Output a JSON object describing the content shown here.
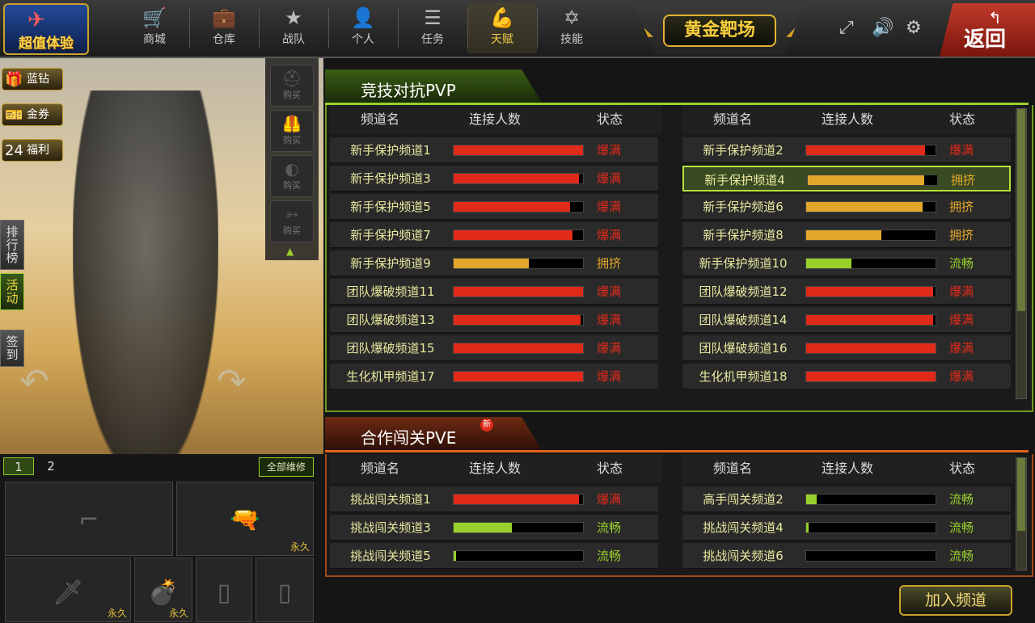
{
  "topbar": {
    "promo_label": "超值体验",
    "nav": [
      {
        "id": "shop",
        "label": "商城",
        "icon": "cart-icon",
        "glyph": "🛒"
      },
      {
        "id": "warehouse",
        "label": "仓库",
        "icon": "briefcase-icon",
        "glyph": "💼"
      },
      {
        "id": "team",
        "label": "战队",
        "icon": "badge-icon",
        "glyph": "★"
      },
      {
        "id": "profile",
        "label": "个人",
        "icon": "person-icon",
        "glyph": "👤"
      },
      {
        "id": "tasks",
        "label": "任务",
        "icon": "list-icon",
        "glyph": "☰"
      },
      {
        "id": "talent",
        "label": "天赋",
        "icon": "muscle-icon",
        "glyph": "💪"
      },
      {
        "id": "skills",
        "label": "技能",
        "icon": "star-of-david-icon",
        "glyph": "✡"
      }
    ],
    "active_nav": "talent",
    "mode_title": "黄金靶场",
    "back_label": "返回"
  },
  "left": {
    "side_buttons": [
      {
        "label": "蓝钻",
        "icon": "gift-icon",
        "glyph": "🎁"
      },
      {
        "label": "金券",
        "icon": "coupon-icon",
        "glyph": "🎫"
      },
      {
        "label": "福利",
        "icon": "calendar-icon",
        "glyph": "24"
      }
    ],
    "rank_tabs": [
      {
        "label": "排行榜",
        "active": false
      },
      {
        "label": "活动",
        "active": true
      },
      {
        "label": "签到",
        "active": false
      }
    ],
    "buy_label": "购买",
    "buy_items": [
      {
        "icon": "helmet-icon",
        "glyph": "⛑"
      },
      {
        "icon": "vest-icon",
        "glyph": "🦺"
      },
      {
        "icon": "shield-icon",
        "glyph": "◐"
      },
      {
        "icon": "gun-icon",
        "glyph": "➳"
      }
    ]
  },
  "loadout": {
    "tabs": [
      "1",
      "2"
    ],
    "repair_label": "全部维修",
    "permanent_label": "永久",
    "slots": [
      {
        "icon": "rifle-icon",
        "glyph": "⌐",
        "permanent": false
      },
      {
        "icon": "pistol-icon",
        "glyph": "🔫",
        "permanent": true
      },
      {
        "icon": "knife-icon",
        "glyph": "🗡",
        "permanent": true
      },
      {
        "icon": "grenade-icon",
        "glyph": "💣",
        "permanent": true
      },
      {
        "icon": "empty-slot-icon",
        "glyph": "▯",
        "permanent": false
      },
      {
        "icon": "empty-slot-icon",
        "glyph": "▯",
        "permanent": false
      }
    ]
  },
  "pvp": {
    "title": "竞技对抗PVP",
    "col_name": "频道名",
    "col_conn": "连接人数",
    "col_status": "状态",
    "channels": [
      {
        "name": "新手保护频道1",
        "fill": 1.0,
        "status": "爆满",
        "color": "#e02a1a"
      },
      {
        "name": "新手保护频道2",
        "fill": 0.92,
        "status": "爆满",
        "color": "#e02a1a"
      },
      {
        "name": "新手保护频道3",
        "fill": 0.97,
        "status": "爆满",
        "color": "#e02a1a"
      },
      {
        "name": "新手保护频道4",
        "fill": 0.9,
        "status": "拥挤",
        "color": "#e2a72a"
      },
      {
        "name": "新手保护频道5",
        "fill": 0.9,
        "status": "爆满",
        "color": "#e02a1a"
      },
      {
        "name": "新手保护频道6",
        "fill": 0.9,
        "status": "拥挤",
        "color": "#e2a72a"
      },
      {
        "name": "新手保护频道7",
        "fill": 0.92,
        "status": "爆满",
        "color": "#e02a1a"
      },
      {
        "name": "新手保护频道8",
        "fill": 0.58,
        "status": "拥挤",
        "color": "#e2a72a"
      },
      {
        "name": "新手保护频道9",
        "fill": 0.58,
        "status": "拥挤",
        "color": "#e2a72a"
      },
      {
        "name": "新手保护频道10",
        "fill": 0.35,
        "status": "流畅",
        "color": "#9ad02c"
      },
      {
        "name": "团队爆破频道11",
        "fill": 1.0,
        "status": "爆满",
        "color": "#e02a1a"
      },
      {
        "name": "团队爆破频道12",
        "fill": 0.98,
        "status": "爆满",
        "color": "#e02a1a"
      },
      {
        "name": "团队爆破频道13",
        "fill": 0.98,
        "status": "爆满",
        "color": "#e02a1a"
      },
      {
        "name": "团队爆破频道14",
        "fill": 0.98,
        "status": "爆满",
        "color": "#e02a1a"
      },
      {
        "name": "团队爆破频道15",
        "fill": 1.0,
        "status": "爆满",
        "color": "#e02a1a"
      },
      {
        "name": "团队爆破频道16",
        "fill": 1.0,
        "status": "爆满",
        "color": "#e02a1a"
      },
      {
        "name": "生化机甲频道17",
        "fill": 1.0,
        "status": "爆满",
        "color": "#e02a1a"
      },
      {
        "name": "生化机甲频道18",
        "fill": 1.0,
        "status": "爆满",
        "color": "#e02a1a"
      }
    ],
    "selected": "新手保护频道4"
  },
  "pve": {
    "title": "合作闯关PVE",
    "new_badge": "新",
    "col_name": "频道名",
    "col_conn": "连接人数",
    "col_status": "状态",
    "channels": [
      {
        "name": "挑战闯关频道1",
        "fill": 0.97,
        "status": "爆满",
        "color": "#e02a1a"
      },
      {
        "name": "高手闯关频道2",
        "fill": 0.08,
        "status": "流畅",
        "color": "#9ad02c"
      },
      {
        "name": "挑战闯关频道3",
        "fill": 0.45,
        "status": "流畅",
        "color": "#9ad02c"
      },
      {
        "name": "挑战闯关频道4",
        "fill": 0.02,
        "status": "流畅",
        "color": "#9ad02c"
      },
      {
        "name": "挑战闯关频道5",
        "fill": 0.02,
        "status": "流畅",
        "color": "#9ad02c"
      },
      {
        "name": "挑战闯关频道6",
        "fill": 0.0,
        "status": "流畅",
        "color": "#9ad02c"
      }
    ]
  },
  "join_label": "加入频道"
}
